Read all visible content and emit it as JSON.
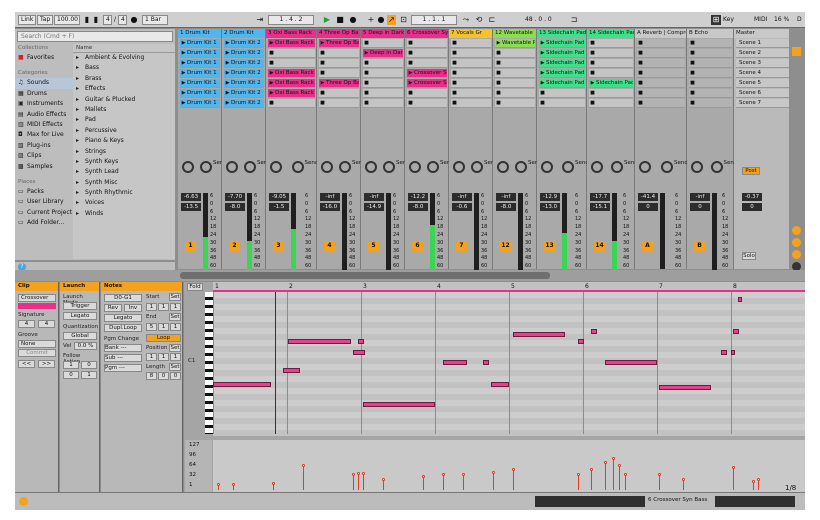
{
  "transport": {
    "link": "Link",
    "tap": "Tap",
    "tempo": "100.00",
    "sig_num": "4",
    "sig_den": "4",
    "quant": "1 Bar",
    "position": "1 . 4 . 2",
    "loop_start": "1 . 1 . 1",
    "loop_len": "48 . 0 . 0",
    "key": "Key",
    "midi": "MIDI",
    "cpu": "16 %",
    "d_label": "D"
  },
  "browser": {
    "search_placeholder": "Search (Cmd + F)",
    "collections_head": "Collections",
    "favorites": "Favorites",
    "categories_head": "Categories",
    "categories": [
      "Sounds",
      "Drums",
      "Instruments",
      "Audio Effects",
      "MIDI Effects",
      "Max for Live",
      "Plug-ins",
      "Clips",
      "Samples"
    ],
    "places_head": "Places",
    "places": [
      "Packs",
      "User Library",
      "Current Project",
      "Add Folder..."
    ],
    "name_head": "Name",
    "names": [
      "Ambient & Evolving",
      "Bass",
      "Brass",
      "Effects",
      "Guitar & Plucked",
      "Mallets",
      "Pad",
      "Percussive",
      "Piano & Keys",
      "Strings",
      "Synth Keys",
      "Synth Lead",
      "Synth Misc",
      "Synth Rhythmic",
      "Voices",
      "Winds"
    ]
  },
  "tracks": [
    {
      "name": "1 Drum Kit",
      "color": "#4fb6ee",
      "num": "1",
      "vol": "-6.63",
      "send": "-13.5",
      "level": 0.45,
      "clips": [
        "Drum Kit 1",
        "Drum Kit 1",
        "Drum Kit 1",
        "Drum Kit 1",
        "Drum Kit 1",
        "Drum Kit 1",
        "Drum Kit 1"
      ]
    },
    {
      "name": "2 Drum Kit",
      "color": "#4fb6ee",
      "num": "2",
      "vol": "-7.70",
      "send": "-8.0",
      "level": 0.4,
      "clips": [
        "Drum Kit 2",
        "Drum Kit 2",
        "Drum Kit 2",
        "Drum Kit 2",
        "Drum Kit 2",
        "Drum Kit 2",
        "Drum Kit 2"
      ]
    },
    {
      "name": "3 Oxi Bass Rack",
      "color": "#e92e8b",
      "num": "3",
      "vol": "-9.05",
      "send": "-1.5",
      "level": 0.55,
      "clips": [
        "Oxi Bass Rack",
        "",
        "",
        "Oxi Bass Rack",
        "Oxi Bass Rack",
        "Oxi Bass Rack",
        ""
      ]
    },
    {
      "name": "4 Three Op Ba",
      "color": "#e92e8b",
      "num": "4",
      "vol": "-inf",
      "send": "-16.0",
      "level": 0,
      "clips": [
        "Three Op Ba",
        "",
        "",
        "",
        "Three Op Ba",
        "",
        ""
      ]
    },
    {
      "name": "5 Deep in Dark",
      "color": "#e92e8b",
      "num": "5",
      "vol": "-inf",
      "send": "-14.9",
      "level": 0,
      "clips": [
        "",
        "Deep in Dark",
        "",
        "",
        "",
        "",
        ""
      ]
    },
    {
      "name": "6 Crossover Sy",
      "color": "#e92e8b",
      "num": "6",
      "vol": "-12.2",
      "send": "-8.0",
      "level": 0.6,
      "clips": [
        "",
        "",
        "",
        "Crossover Sy",
        "Crossover Sy",
        "",
        ""
      ]
    },
    {
      "name": "7 Vocals Gr",
      "color": "#f2c230",
      "num": "7",
      "vol": "-inf",
      "send": "-0.6",
      "level": 0,
      "clips": [
        "",
        "",
        "",
        "",
        "",
        "",
        ""
      ]
    },
    {
      "name": "12 Wavetable",
      "color": "#8edb54",
      "num": "12",
      "vol": "-inf",
      "send": "-8.0",
      "level": 0,
      "clips": [
        "Wavetable P",
        "",
        "",
        "",
        "",
        "",
        ""
      ]
    },
    {
      "name": "13 Sidechain Pad",
      "color": "#3fe08a",
      "num": "13",
      "vol": "-12.9",
      "send": "-13.0",
      "level": 0.5,
      "clips": [
        "Sidechain Pad",
        "Sidechain Pad",
        "Sidechain Pad",
        "Sidechain Pad",
        "Sidechain Pad",
        "",
        ""
      ]
    },
    {
      "name": "14 Sidechain Pad",
      "color": "#3fe08a",
      "num": "14",
      "vol": "-17.7",
      "send": "-15.1",
      "level": 0.4,
      "clips": [
        "",
        "",
        "",
        "",
        "Sidechain Pad",
        "",
        ""
      ]
    },
    {
      "name": "A Reverb | Compre",
      "color": "#c8c8c8",
      "num": "A",
      "vol": "-41.4",
      "send": "0",
      "level": 0.05,
      "clips": []
    },
    {
      "name": "B Echo",
      "color": "#c8c8c8",
      "num": "B",
      "vol": "-inf",
      "send": "0",
      "level": 0,
      "clips": []
    }
  ],
  "master": {
    "name": "Master",
    "vol": "-0.37",
    "send": "0",
    "post": "Post",
    "solo": "Solo",
    "scenes": [
      "Scene 1",
      "Scene 2",
      "Scene 3",
      "Scene 4",
      "Scene 5",
      "Scene 6",
      "Scene 7"
    ]
  },
  "meter_scale": [
    "6",
    "0",
    "6",
    "12",
    "18",
    "24",
    "30",
    "36",
    "48",
    "60"
  ],
  "sends_label": "Sends",
  "clip_panel": {
    "title": "Clip",
    "name": "Crossover Syn",
    "sig_head": "Signature",
    "sig_num": "4",
    "sig_den": "4",
    "groove_head": "Groove",
    "groove_val": "None",
    "commit": "Commit",
    "nav_left": "<<",
    "nav_right": ">>"
  },
  "launch_panel": {
    "title": "Launch",
    "mode_head": "Launch Mode",
    "mode": "Trigger",
    "legato": "Legato",
    "quant_head": "Quantization",
    "quant": "Global",
    "vel_head": "Vel",
    "vel": "0.0 %",
    "follow_head": "Follow Action",
    "fa1": "1",
    "fa2": "0",
    "fa3": "0",
    "fa4": "1"
  },
  "notes_panel": {
    "title": "Notes",
    "range": "D0-G1",
    "start_head": "Start",
    "set": "Set",
    "start": [
      "1",
      "1",
      "1"
    ],
    "end_head": "End",
    "end": [
      "5",
      "1",
      "1"
    ],
    "rev": "Rev",
    "inv": "Inv",
    "legato": "Legato",
    "dupl": "Dupl.Loop",
    "loop": "Loop",
    "position_head": "Position",
    "position": [
      "1",
      "1",
      "1"
    ],
    "length_head": "Length",
    "length": [
      "8",
      "0",
      "0"
    ],
    "pgm_head": "Pgm Change",
    "bank": "Bank ---",
    "sub": "Sub ---",
    "pgm": "Pgm ---"
  },
  "roll": {
    "fold": "Fold",
    "bars": [
      "1",
      "2",
      "3",
      "4",
      "5",
      "6",
      "7",
      "8"
    ],
    "c1": "C1",
    "vel_scale": [
      "127",
      "96",
      "64",
      "32",
      "1"
    ],
    "page": "1/8"
  },
  "status": {
    "clip_label": "6 Crossover Syn Bass"
  },
  "colors": {
    "pink": "#e92e8b",
    "orange": "#f4a21d",
    "green": "#3bd454",
    "velocity": "#e53a23"
  }
}
